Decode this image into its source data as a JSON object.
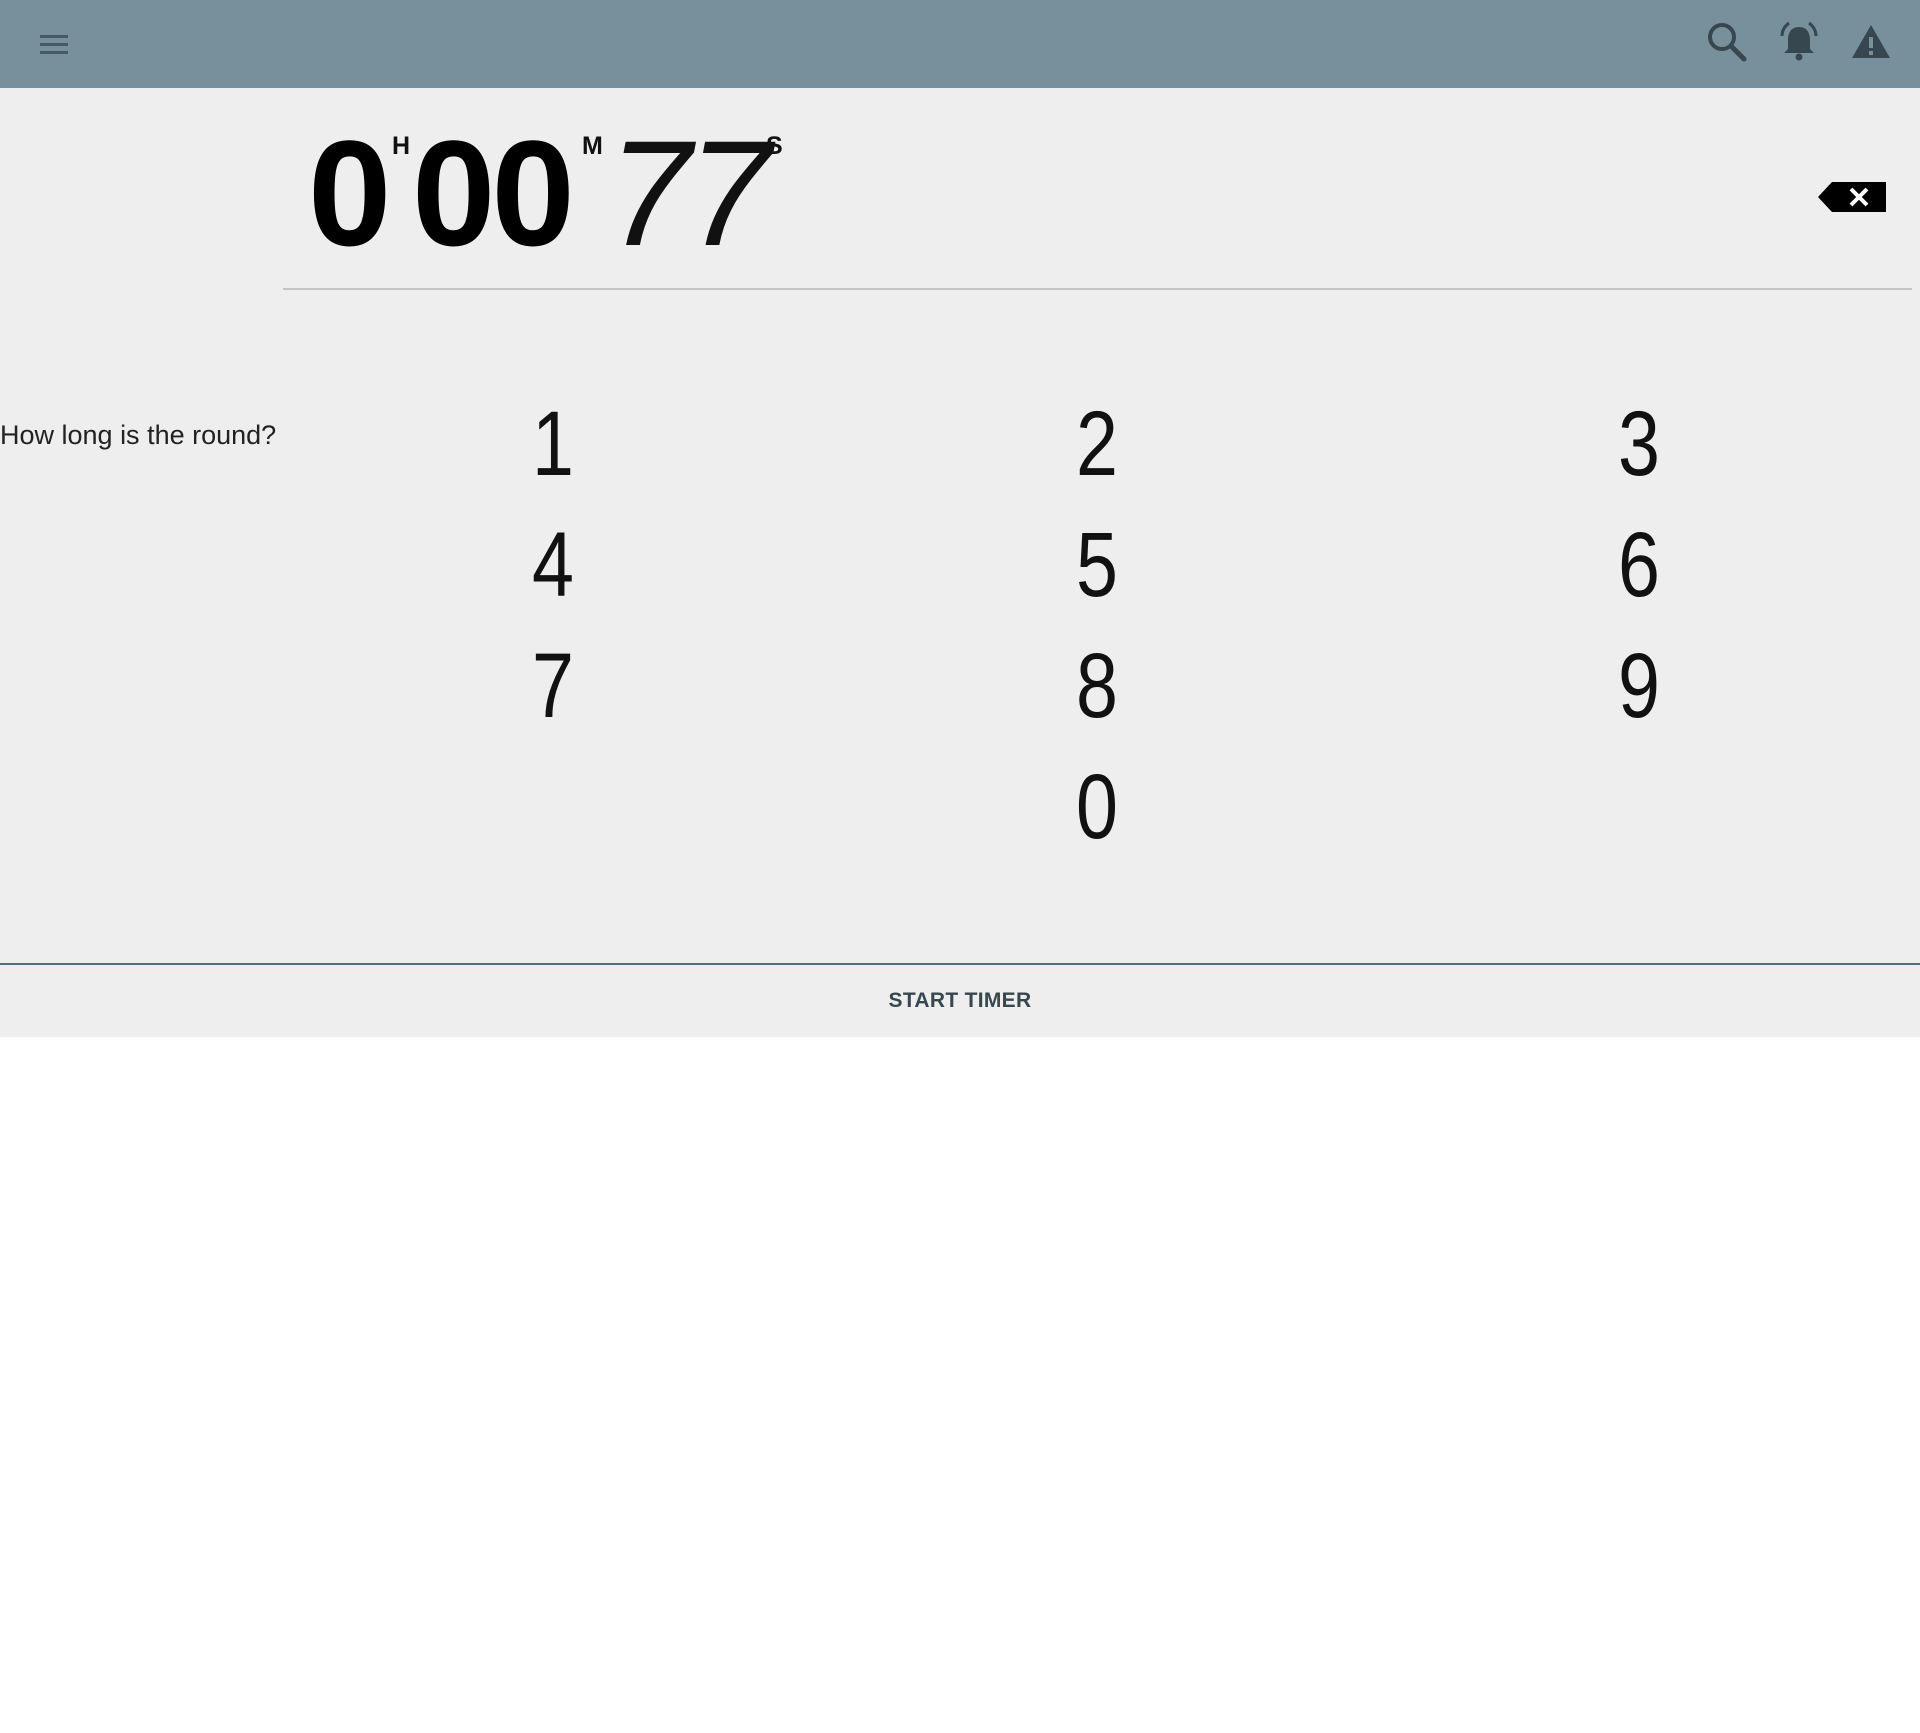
{
  "toolbar": {
    "icons": [
      "menu-icon",
      "search-icon",
      "alarm-icon",
      "warning-icon"
    ],
    "background": "#78909c"
  },
  "timer": {
    "hours": "0",
    "minutes": "00",
    "seconds": "77",
    "hours_unit": "H",
    "minutes_unit": "M",
    "seconds_unit": "S"
  },
  "prompt": "How long is the round?",
  "keypad": {
    "k1": "1",
    "k2": "2",
    "k3": "3",
    "k4": "4",
    "k5": "5",
    "k6": "6",
    "k7": "7",
    "k8": "8",
    "k9": "9",
    "k0": "0"
  },
  "start_button_label": "START TIMER",
  "colors": {
    "panel": "#eeeeee",
    "accent_text": "#37474f"
  }
}
